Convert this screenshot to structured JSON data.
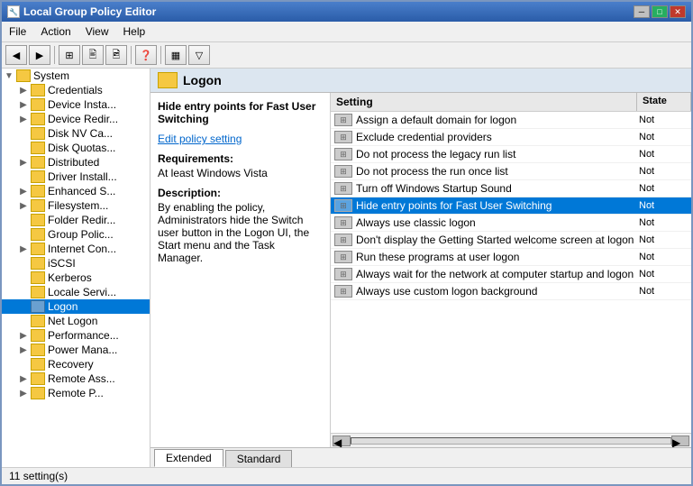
{
  "window": {
    "title": "Local Group Policy Editor",
    "title_icon": "🔧"
  },
  "menu": {
    "items": [
      {
        "label": "File",
        "id": "file"
      },
      {
        "label": "Action",
        "id": "action"
      },
      {
        "label": "View",
        "id": "view"
      },
      {
        "label": "Help",
        "id": "help"
      }
    ]
  },
  "toolbar": {
    "buttons": [
      {
        "label": "◀",
        "id": "back",
        "disabled": false
      },
      {
        "label": "▶",
        "id": "forward",
        "disabled": false
      },
      {
        "label": "⬆",
        "id": "up",
        "disabled": false
      },
      {
        "label": "⊞",
        "id": "show-hide",
        "disabled": false
      },
      {
        "label": "🖨",
        "id": "print",
        "disabled": false
      },
      {
        "label": "⊞",
        "id": "refresh",
        "disabled": false
      },
      {
        "label": "❓",
        "id": "help",
        "disabled": false
      },
      {
        "label": "▦",
        "id": "view2",
        "disabled": false
      },
      {
        "label": "▽",
        "id": "filter",
        "disabled": false
      }
    ]
  },
  "tree": {
    "items": [
      {
        "label": "System",
        "level": 0,
        "expanded": true,
        "id": "system"
      },
      {
        "label": "Credentials",
        "level": 1,
        "id": "credentials"
      },
      {
        "label": "Device Insta...",
        "level": 1,
        "id": "device-insta"
      },
      {
        "label": "Device Redir...",
        "level": 1,
        "id": "device-redir"
      },
      {
        "label": "Disk NV Ca...",
        "level": 1,
        "id": "disk-nv"
      },
      {
        "label": "Disk Quotas...",
        "level": 1,
        "id": "disk-quotas"
      },
      {
        "label": "Distributed",
        "level": 1,
        "id": "distributed"
      },
      {
        "label": "Driver Install...",
        "level": 1,
        "id": "driver-install"
      },
      {
        "label": "Enhanced S...",
        "level": 1,
        "id": "enhanced"
      },
      {
        "label": "Filesystem...",
        "level": 1,
        "id": "filesystem"
      },
      {
        "label": "Folder Redir...",
        "level": 1,
        "id": "folder-redir"
      },
      {
        "label": "Group Polic...",
        "level": 1,
        "id": "group-policy"
      },
      {
        "label": "Internet Con...",
        "level": 1,
        "id": "internet-con"
      },
      {
        "label": "iSCSI",
        "level": 1,
        "id": "iscsi"
      },
      {
        "label": "Kerberos",
        "level": 1,
        "id": "kerberos"
      },
      {
        "label": "Locale Servi...",
        "level": 1,
        "id": "locale"
      },
      {
        "label": "Logon",
        "level": 1,
        "id": "logon",
        "selected": false
      },
      {
        "label": "Net Logon",
        "level": 1,
        "id": "net-logon"
      },
      {
        "label": "Performance...",
        "level": 1,
        "id": "performance"
      },
      {
        "label": "Power Mana...",
        "level": 1,
        "id": "power"
      },
      {
        "label": "Recovery",
        "level": 1,
        "id": "recovery"
      },
      {
        "label": "Remote Ass...",
        "level": 1,
        "id": "remote-ass"
      },
      {
        "label": "Remote P...",
        "level": 1,
        "id": "remote-p"
      }
    ]
  },
  "header": {
    "title": "Logon"
  },
  "description": {
    "title": "Hide entry points for Fast User Switching",
    "edit_link": "Edit policy setting",
    "requirements_label": "Requirements:",
    "requirements_value": "At least Windows Vista",
    "description_label": "Description:",
    "description_text": "By enabling the policy, Administrators hide the Switch user button in the Logon UI, the Start menu and the Task Manager."
  },
  "list": {
    "columns": [
      {
        "label": "Setting",
        "id": "setting"
      },
      {
        "label": "State",
        "id": "state"
      }
    ],
    "rows": [
      {
        "label": "Assign a default domain for logon",
        "state": "Not",
        "selected": false
      },
      {
        "label": "Exclude credential providers",
        "state": "Not",
        "selected": false
      },
      {
        "label": "Do not process the legacy run list",
        "state": "Not",
        "selected": false
      },
      {
        "label": "Do not process the run once list",
        "state": "Not",
        "selected": false
      },
      {
        "label": "Turn off Windows Startup Sound",
        "state": "Not",
        "selected": false
      },
      {
        "label": "Hide entry points for Fast User Switching",
        "state": "Not",
        "selected": true
      },
      {
        "label": "Always use classic logon",
        "state": "Not",
        "selected": false
      },
      {
        "label": "Don't display the Getting Started welcome screen at logon",
        "state": "Not",
        "selected": false
      },
      {
        "label": "Run these programs at user logon",
        "state": "Not",
        "selected": false
      },
      {
        "label": "Always wait for the network at computer startup and logon",
        "state": "Not",
        "selected": false
      },
      {
        "label": "Always use custom logon background",
        "state": "Not",
        "selected": false
      }
    ]
  },
  "tabs": [
    {
      "label": "Extended",
      "active": true
    },
    {
      "label": "Standard",
      "active": false
    }
  ],
  "status": {
    "text": "11 setting(s)"
  }
}
